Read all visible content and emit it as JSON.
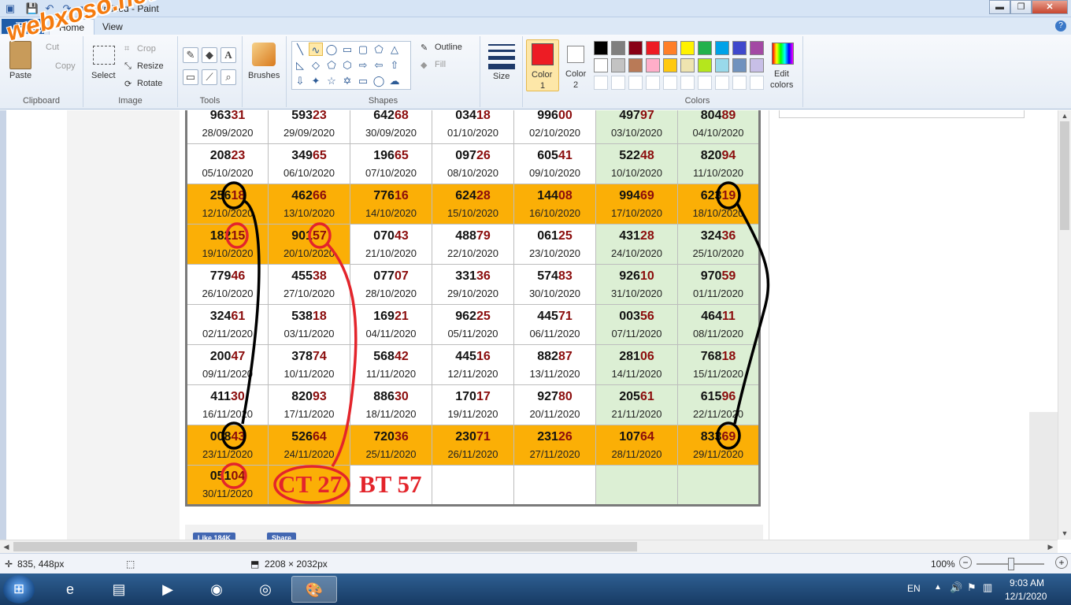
{
  "window": {
    "title": "Untitled - Paint",
    "controls": {
      "minimize": "▬",
      "maximize": "❐",
      "close": "✕"
    }
  },
  "quick_access": {
    "save_icon": "save-icon",
    "undo_icon": "undo-icon",
    "redo_icon": "redo-icon",
    "customize_icon": "dropdown-icon"
  },
  "ribbon_tabs": {
    "file": "☰ ▾",
    "home": "Home",
    "view": "View",
    "help": "?"
  },
  "ribbon": {
    "clipboard": {
      "label": "Clipboard",
      "paste": "Paste",
      "cut": "Cut",
      "copy": "Copy"
    },
    "image": {
      "label": "Image",
      "select": "Select",
      "crop": "Crop",
      "resize": "Resize",
      "rotate": "Rotate"
    },
    "tools": {
      "label": "Tools"
    },
    "brushes": {
      "label": "Brushes"
    },
    "shapes": {
      "label": "Shapes",
      "outline": "Outline",
      "fill": "Fill"
    },
    "size": {
      "label": "Size"
    },
    "color1": {
      "label1": "Color",
      "label2": "1",
      "value": "#ed1c24"
    },
    "color2": {
      "label1": "Color",
      "label2": "2",
      "value": "#ffffff"
    },
    "colors": {
      "label": "Colors",
      "palette_row1": [
        "#000000",
        "#7f7f7f",
        "#880015",
        "#ed1c24",
        "#ff7f27",
        "#fff200",
        "#22b14c",
        "#00a2e8",
        "#3f48cc",
        "#a349a4"
      ],
      "palette_row2": [
        "#ffffff",
        "#c3c3c3",
        "#b97a57",
        "#ffaec9",
        "#ffc90e",
        "#efe4b0",
        "#b5e61d",
        "#99d9ea",
        "#7092be",
        "#c8bfe7"
      ]
    },
    "edit_colors": {
      "label1": "Edit",
      "label2": "colors"
    }
  },
  "watermark": "webxoso.net",
  "results_table": {
    "rows": [
      {
        "orange": false,
        "cells": [
          {
            "head": "963",
            "tail": "31",
            "date": "28/09/2020"
          },
          {
            "head": "593",
            "tail": "23",
            "date": "29/09/2020"
          },
          {
            "head": "642",
            "tail": "68",
            "date": "30/09/2020"
          },
          {
            "head": "034",
            "tail": "18",
            "date": "01/10/2020"
          },
          {
            "head": "996",
            "tail": "00",
            "date": "02/10/2020"
          },
          {
            "head": "497",
            "tail": "97",
            "date": "03/10/2020"
          },
          {
            "head": "804",
            "tail": "89",
            "date": "04/10/2020"
          }
        ]
      },
      {
        "orange": false,
        "cells": [
          {
            "head": "208",
            "tail": "23",
            "date": "05/10/2020"
          },
          {
            "head": "349",
            "tail": "65",
            "date": "06/10/2020"
          },
          {
            "head": "196",
            "tail": "65",
            "date": "07/10/2020"
          },
          {
            "head": "097",
            "tail": "26",
            "date": "08/10/2020"
          },
          {
            "head": "605",
            "tail": "41",
            "date": "09/10/2020"
          },
          {
            "head": "522",
            "tail": "48",
            "date": "10/10/2020"
          },
          {
            "head": "820",
            "tail": "94",
            "date": "11/10/2020"
          }
        ]
      },
      {
        "orange": true,
        "cells": [
          {
            "head": "256",
            "tail": "18",
            "date": "12/10/2020"
          },
          {
            "head": "462",
            "tail": "66",
            "date": "13/10/2020"
          },
          {
            "head": "776",
            "tail": "16",
            "date": "14/10/2020"
          },
          {
            "head": "624",
            "tail": "28",
            "date": "15/10/2020"
          },
          {
            "head": "144",
            "tail": "08",
            "date": "16/10/2020"
          },
          {
            "head": "994",
            "tail": "69",
            "date": "17/10/2020"
          },
          {
            "head": "623",
            "tail": "19",
            "date": "18/10/2020"
          }
        ]
      },
      {
        "orange": false,
        "cells": [
          {
            "head": "182",
            "tail": "15",
            "date": "19/10/2020",
            "bg": "orange"
          },
          {
            "head": "901",
            "tail": "57",
            "date": "20/10/2020",
            "bg": "orange"
          },
          {
            "head": "070",
            "tail": "43",
            "date": "21/10/2020"
          },
          {
            "head": "488",
            "tail": "79",
            "date": "22/10/2020"
          },
          {
            "head": "061",
            "tail": "25",
            "date": "23/10/2020"
          },
          {
            "head": "431",
            "tail": "28",
            "date": "24/10/2020"
          },
          {
            "head": "324",
            "tail": "36",
            "date": "25/10/2020"
          }
        ]
      },
      {
        "orange": false,
        "cells": [
          {
            "head": "779",
            "tail": "46",
            "date": "26/10/2020"
          },
          {
            "head": "455",
            "tail": "38",
            "date": "27/10/2020"
          },
          {
            "head": "077",
            "tail": "07",
            "date": "28/10/2020"
          },
          {
            "head": "331",
            "tail": "36",
            "date": "29/10/2020"
          },
          {
            "head": "574",
            "tail": "83",
            "date": "30/10/2020"
          },
          {
            "head": "926",
            "tail": "10",
            "date": "31/10/2020"
          },
          {
            "head": "970",
            "tail": "59",
            "date": "01/11/2020"
          }
        ]
      },
      {
        "orange": false,
        "cells": [
          {
            "head": "324",
            "tail": "61",
            "date": "02/11/2020"
          },
          {
            "head": "538",
            "tail": "18",
            "date": "03/11/2020"
          },
          {
            "head": "169",
            "tail": "21",
            "date": "04/11/2020"
          },
          {
            "head": "962",
            "tail": "25",
            "date": "05/11/2020"
          },
          {
            "head": "445",
            "tail": "71",
            "date": "06/11/2020"
          },
          {
            "head": "003",
            "tail": "56",
            "date": "07/11/2020"
          },
          {
            "head": "464",
            "tail": "11",
            "date": "08/11/2020"
          }
        ]
      },
      {
        "orange": false,
        "cells": [
          {
            "head": "200",
            "tail": "47",
            "date": "09/11/2020"
          },
          {
            "head": "378",
            "tail": "74",
            "date": "10/11/2020"
          },
          {
            "head": "568",
            "tail": "42",
            "date": "11/11/2020"
          },
          {
            "head": "445",
            "tail": "16",
            "date": "12/11/2020"
          },
          {
            "head": "882",
            "tail": "87",
            "date": "13/11/2020"
          },
          {
            "head": "281",
            "tail": "06",
            "date": "14/11/2020"
          },
          {
            "head": "768",
            "tail": "18",
            "date": "15/11/2020"
          }
        ]
      },
      {
        "orange": false,
        "cells": [
          {
            "head": "411",
            "tail": "30",
            "date": "16/11/2020"
          },
          {
            "head": "820",
            "tail": "93",
            "date": "17/11/2020"
          },
          {
            "head": "886",
            "tail": "30",
            "date": "18/11/2020"
          },
          {
            "head": "170",
            "tail": "17",
            "date": "19/11/2020"
          },
          {
            "head": "927",
            "tail": "80",
            "date": "20/11/2020"
          },
          {
            "head": "205",
            "tail": "61",
            "date": "21/11/2020"
          },
          {
            "head": "615",
            "tail": "96",
            "date": "22/11/2020"
          }
        ]
      },
      {
        "orange": true,
        "cells": [
          {
            "head": "008",
            "tail": "43",
            "date": "23/11/2020"
          },
          {
            "head": "526",
            "tail": "64",
            "date": "24/11/2020"
          },
          {
            "head": "720",
            "tail": "36",
            "date": "25/11/2020"
          },
          {
            "head": "230",
            "tail": "71",
            "date": "26/11/2020"
          },
          {
            "head": "231",
            "tail": "26",
            "date": "27/11/2020"
          },
          {
            "head": "107",
            "tail": "64",
            "date": "28/11/2020"
          },
          {
            "head": "833",
            "tail": "69",
            "date": "29/11/2020"
          }
        ]
      },
      {
        "orange": false,
        "cells": [
          {
            "head": "051",
            "tail": "04",
            "date": "30/11/2020",
            "bg": "orange"
          },
          {
            "head": "",
            "tail": "",
            "date": "",
            "bg": "orange"
          },
          {
            "head": "",
            "tail": "",
            "date": ""
          },
          {
            "head": "",
            "tail": "",
            "date": ""
          },
          {
            "head": "",
            "tail": "",
            "date": ""
          },
          {
            "head": "",
            "tail": "",
            "date": ""
          },
          {
            "head": "",
            "tail": "",
            "date": ""
          }
        ]
      }
    ]
  },
  "annotations": {
    "ct": "CT 27",
    "bt": "BT 57",
    "ink_red": "#e3242b",
    "ink_black": "#000000"
  },
  "below_table": {
    "like": "Like 184K",
    "share": "Share"
  },
  "statusbar": {
    "cursor": "835, 448px",
    "image_size": "2208 × 2032px",
    "zoom": "100%",
    "zoom_minus": "−",
    "zoom_plus": "+"
  },
  "taskbar": {
    "start": "⊞",
    "apps": [
      {
        "name": "ie",
        "icon": "e"
      },
      {
        "name": "explorer",
        "icon": "▤"
      },
      {
        "name": "media",
        "icon": "▶"
      },
      {
        "name": "chrome",
        "icon": "◉"
      },
      {
        "name": "coccoc",
        "icon": "◎"
      },
      {
        "name": "paint",
        "icon": "🎨"
      }
    ],
    "lang": "EN",
    "time": "9:03 AM",
    "date": "12/1/2020"
  }
}
